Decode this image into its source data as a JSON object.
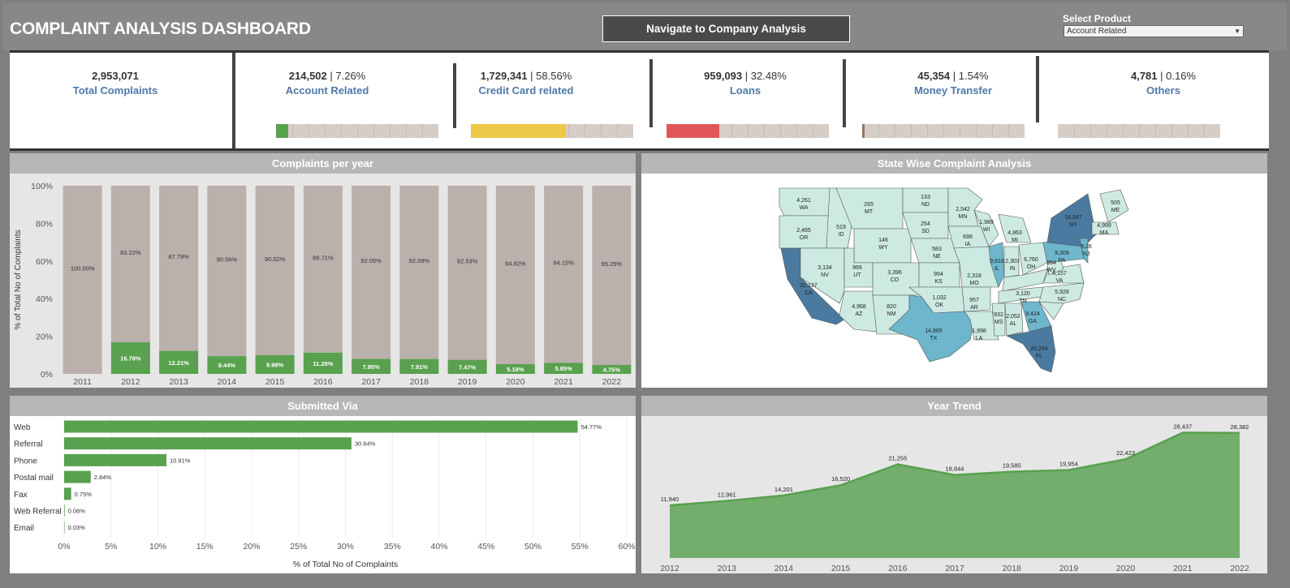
{
  "header": {
    "title": "COMPLAINT ANALYSIS DASHBOARD",
    "nav_button": "Navigate to Company Analysis",
    "select_label": "Select Product",
    "select_value": "Account Related"
  },
  "kpis": [
    {
      "value": "2,953,071",
      "pct": "",
      "label": "Total Complaints",
      "share": null,
      "color": ""
    },
    {
      "value": "214,502",
      "pct": "7.26%",
      "label": "Account Related",
      "share": 0.0726,
      "color": "#59a14f"
    },
    {
      "value": "1,729,341",
      "pct": "58.56%",
      "label": "Credit Card related",
      "share": 0.5856,
      "color": "#edc948"
    },
    {
      "value": "959,093",
      "pct": "32.48%",
      "label": "Loans",
      "share": 0.3248,
      "color": "#e15759"
    },
    {
      "value": "45,354",
      "pct": "1.54%",
      "label": "Money Transfer",
      "share": 0.0154,
      "color": "#9c755f"
    },
    {
      "value": "4,781",
      "pct": "0.16%",
      "label": "Others",
      "share": 0.0016,
      "color": "#d6cdc7"
    }
  ],
  "panels": {
    "per_year": "Complaints per year",
    "state": "State Wise Complaint Analysis",
    "submitted": "Submitted Via",
    "trend": "Year Trend"
  },
  "colors": {
    "green": "#59a14f",
    "gray_bar": "#bab0ac",
    "map_light": "#cdeae2",
    "map_mid": "#6eb6cc",
    "map_dark": "#4a7aa0"
  },
  "chart_data": [
    {
      "type": "bar",
      "stacked": true,
      "title": "Complaints per year",
      "ylabel": "% of Total No of Complaints",
      "yticks": [
        "0%",
        "20%",
        "40%",
        "60%",
        "80%",
        "100%"
      ],
      "ylim": [
        0,
        100
      ],
      "categories": [
        "2011",
        "2012",
        "2013",
        "2014",
        "2015",
        "2016",
        "2017",
        "2018",
        "2019",
        "2020",
        "2021",
        "2022"
      ],
      "series": [
        {
          "name": "Account Related",
          "values": [
            0,
            16.78,
            12.21,
            9.44,
            9.98,
            11.29,
            7.95,
            7.91,
            7.47,
            5.18,
            5.85,
            4.75
          ],
          "labels": [
            "",
            "16.78%",
            "12.21%",
            "9.44%",
            "9.98%",
            "11.29%",
            "7.95%",
            "7.91%",
            "7.47%",
            "5.18%",
            "5.85%",
            "4.75%"
          ]
        },
        {
          "name": "Other",
          "values": [
            100,
            83.22,
            87.79,
            90.56,
            90.02,
            88.71,
            92.05,
            92.09,
            92.53,
            94.82,
            94.15,
            95.25
          ],
          "labels": [
            "100.00%",
            "83.22%",
            "87.79%",
            "90.56%",
            "90.02%",
            "88.71%",
            "92.05%",
            "92.09%",
            "92.53%",
            "94.82%",
            "94.15%",
            "95.25%"
          ]
        }
      ]
    },
    {
      "type": "bar",
      "orientation": "horizontal",
      "title": "Submitted Via",
      "xlabel": "% of Total No of Complaints",
      "xticks": [
        "0%",
        "5%",
        "10%",
        "15%",
        "20%",
        "25%",
        "30%",
        "35%",
        "40%",
        "45%",
        "50%",
        "55%",
        "60%"
      ],
      "xlim": [
        0,
        60
      ],
      "categories": [
        "Web",
        "Referral",
        "Phone",
        "Postal mail",
        "Fax",
        "Web Referral",
        "Email"
      ],
      "values": [
        54.77,
        30.64,
        10.91,
        2.84,
        0.75,
        0.06,
        0.03
      ],
      "labels": [
        "54.77%",
        "30.64%",
        "10.91%",
        "2.84%",
        "0.75%",
        "0.06%",
        "0.03%"
      ]
    },
    {
      "type": "area",
      "title": "Year Trend",
      "x": [
        "2012",
        "2013",
        "2014",
        "2015",
        "2016",
        "2017",
        "2018",
        "2019",
        "2020",
        "2021",
        "2022"
      ],
      "values": [
        11940,
        12961,
        14201,
        16520,
        21255,
        18844,
        19585,
        19954,
        22423,
        28437,
        28382
      ],
      "labels": [
        "11,940",
        "12,961",
        "14,201",
        "16,520",
        "21,255",
        "18,844",
        "19,585",
        "19,954",
        "22,423",
        "28,437",
        "28,382"
      ]
    }
  ],
  "map": {
    "states": [
      {
        "abbr": "WA",
        "value": "4,261",
        "shade": "light"
      },
      {
        "abbr": "OR",
        "value": "2,465",
        "shade": "light"
      },
      {
        "abbr": "CA",
        "value": "32,137",
        "shade": "dark"
      },
      {
        "abbr": "ID",
        "value": "519",
        "shade": "light"
      },
      {
        "abbr": "NV",
        "value": "3,134",
        "shade": "light"
      },
      {
        "abbr": "MT",
        "value": "265",
        "shade": "light"
      },
      {
        "abbr": "WY",
        "value": "146",
        "shade": "light"
      },
      {
        "abbr": "UT",
        "value": "966",
        "shade": "light"
      },
      {
        "abbr": "AZ",
        "value": "4,968",
        "shade": "light"
      },
      {
        "abbr": "CO",
        "value": "3,396",
        "shade": "light"
      },
      {
        "abbr": "NM",
        "value": "820",
        "shade": "light"
      },
      {
        "abbr": "ND",
        "value": "133",
        "shade": "light"
      },
      {
        "abbr": "SD",
        "value": "254",
        "shade": "light"
      },
      {
        "abbr": "NE",
        "value": "583",
        "shade": "light"
      },
      {
        "abbr": "KS",
        "value": "994",
        "shade": "light"
      },
      {
        "abbr": "OK",
        "value": "1,032",
        "shade": "light"
      },
      {
        "abbr": "TX",
        "value": "14,865",
        "shade": "mid"
      },
      {
        "abbr": "MN",
        "value": "2,542",
        "shade": "light"
      },
      {
        "abbr": "IA",
        "value": "698",
        "shade": "light"
      },
      {
        "abbr": "MO",
        "value": "2,318",
        "shade": "light"
      },
      {
        "abbr": "AR",
        "value": "957",
        "shade": "light"
      },
      {
        "abbr": "LA",
        "value": "1,998",
        "shade": "light"
      },
      {
        "abbr": "WI",
        "value": "1,989",
        "shade": "light"
      },
      {
        "abbr": "IL",
        "value": "9,618",
        "shade": "mid"
      },
      {
        "abbr": "MI",
        "value": "4,863",
        "shade": "light"
      },
      {
        "abbr": "IN",
        "value": "2,303",
        "shade": "light"
      },
      {
        "abbr": "OH",
        "value": "6,760",
        "shade": "light"
      },
      {
        "abbr": "KY",
        "value": "",
        "shade": "light"
      },
      {
        "abbr": "TN",
        "value": "3,120",
        "shade": "light"
      },
      {
        "abbr": "MS",
        "value": "932",
        "shade": "light"
      },
      {
        "abbr": "AL",
        "value": "2,052",
        "shade": "light"
      },
      {
        "abbr": "GA",
        "value": "9,424",
        "shade": "mid"
      },
      {
        "abbr": "FL",
        "value": "20,254",
        "shade": "dark"
      },
      {
        "abbr": "SC",
        "value": "",
        "shade": "light"
      },
      {
        "abbr": "NC",
        "value": "5,928",
        "shade": "light"
      },
      {
        "abbr": "VA",
        "value": "6,157",
        "shade": "light"
      },
      {
        "abbr": "WV",
        "value": "554",
        "shade": "light"
      },
      {
        "abbr": "PA",
        "value": "9,309",
        "shade": "mid"
      },
      {
        "abbr": "NY",
        "value": "18,547",
        "shade": "dark"
      },
      {
        "abbr": "NJ",
        "value": "9,28",
        "shade": "mid"
      },
      {
        "abbr": "MA",
        "value": "4,999",
        "shade": "light"
      },
      {
        "abbr": "ME",
        "value": "505",
        "shade": "light"
      }
    ]
  }
}
